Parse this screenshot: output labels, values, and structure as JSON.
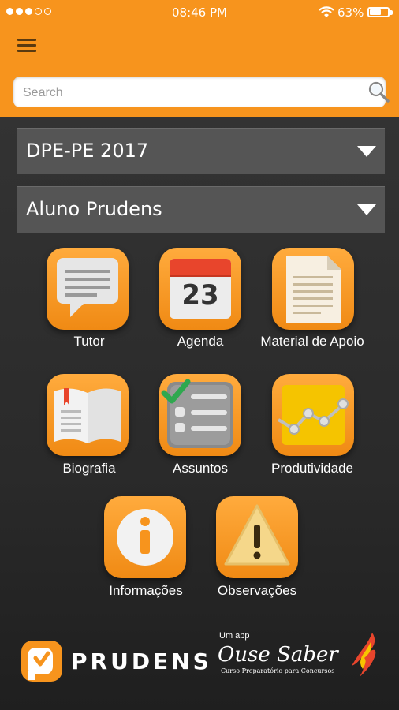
{
  "status_bar": {
    "time": "08:46 PM",
    "battery": "63%",
    "battery_level": 0.63,
    "signal_filled": 3,
    "signal_total": 5
  },
  "search": {
    "placeholder": "Search"
  },
  "dropdowns": {
    "course": "DPE-PE 2017",
    "user": "Aluno Prudens"
  },
  "tiles": {
    "tutor": "Tutor",
    "agenda": "Agenda",
    "agenda_date": "23",
    "material": "Material de Apoio",
    "biografia": "Biografia",
    "assuntos": "Assuntos",
    "produtividade": "Produtividade",
    "informacoes": "Informações",
    "observacoes": "Observações"
  },
  "footer": {
    "brand": "PRUDENS",
    "um_app": "Um app",
    "partner": "Ouse Saber",
    "partner_tagline": "Curso Preparatório para Concursos"
  },
  "colors": {
    "header": "#f7941d",
    "tile": "#f7941d",
    "dropdown": "#555555",
    "background": "#2b2b2b"
  }
}
